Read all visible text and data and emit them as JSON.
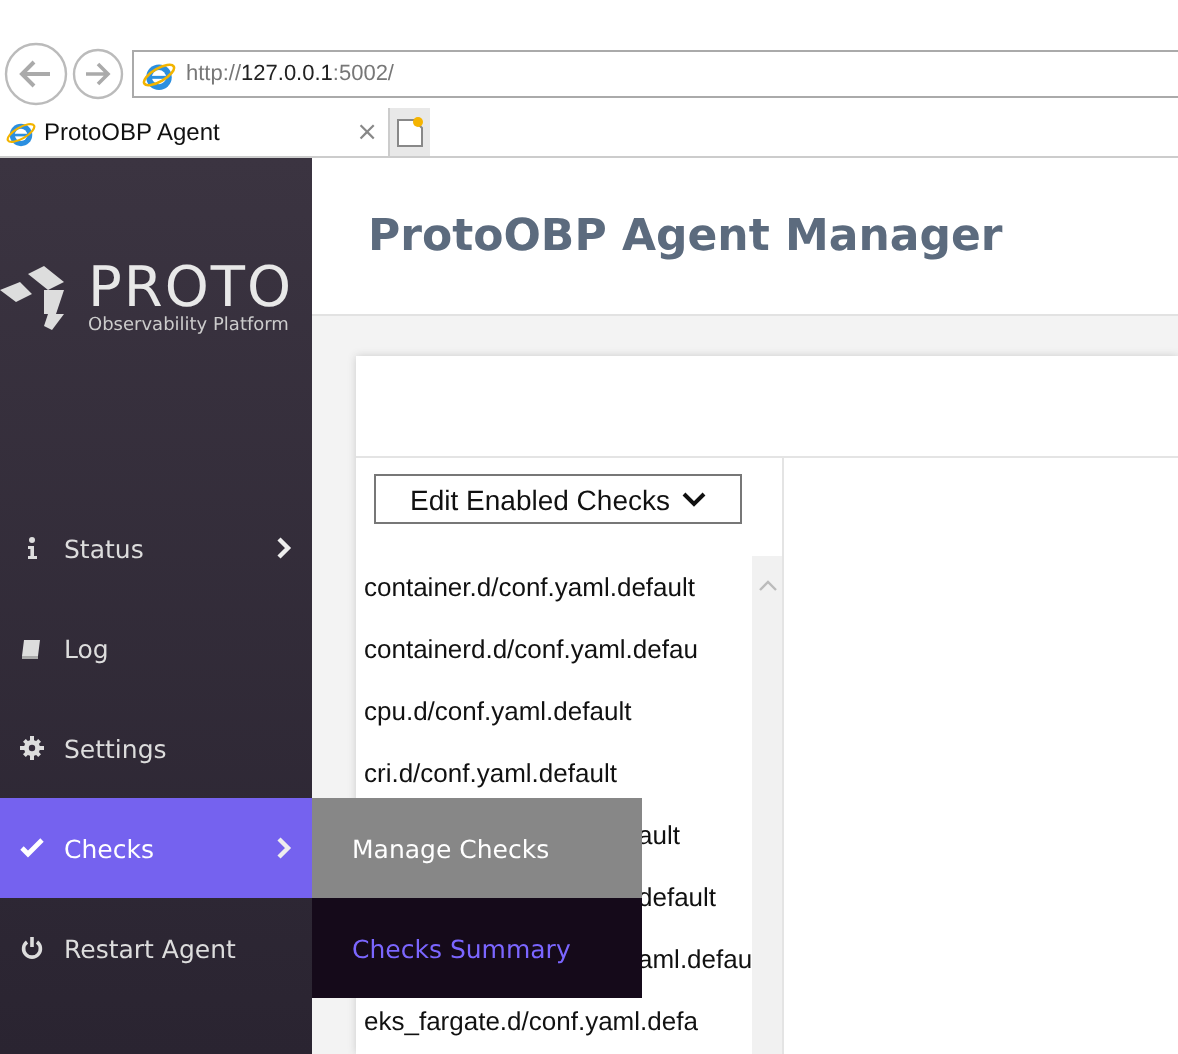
{
  "browser": {
    "address": {
      "scheme": "http://",
      "host": "127.0.0.1",
      "port": ":5002/"
    },
    "tab": {
      "title": "ProtoOBP Agent",
      "close": "×"
    }
  },
  "logo": {
    "name": "PROTO",
    "tagline": "Observability Platform"
  },
  "sidebar": {
    "items": [
      {
        "label": "Status",
        "has_submenu": true,
        "selected": false
      },
      {
        "label": "Log",
        "has_submenu": false,
        "selected": false
      },
      {
        "label": "Settings",
        "has_submenu": false,
        "selected": false
      },
      {
        "label": "Checks",
        "has_submenu": true,
        "selected": true
      },
      {
        "label": "Restart Agent",
        "has_submenu": false,
        "selected": false
      }
    ]
  },
  "submenu": {
    "items": [
      {
        "label": "Manage Checks",
        "selected": false
      },
      {
        "label": "Checks Summary",
        "selected": true
      }
    ]
  },
  "header": {
    "title": "ProtoOBP Agent Manager"
  },
  "checks": {
    "dropdown": "Edit Enabled Checks",
    "files": [
      {
        "text": "container.d/conf.yaml.default",
        "kind": "full"
      },
      {
        "text": "containerd.d/conf.yaml.defau",
        "kind": "full"
      },
      {
        "text": "cpu.d/conf.yaml.default",
        "kind": "full"
      },
      {
        "text": "cri.d/conf.yaml.default",
        "kind": "full"
      },
      {
        "text": "ault",
        "kind": "covered"
      },
      {
        "text": "default",
        "kind": "covered"
      },
      {
        "text": "aml.defau",
        "kind": "covered"
      },
      {
        "text": "eks_fargate.d/conf.yaml.defa",
        "kind": "full"
      }
    ]
  }
}
